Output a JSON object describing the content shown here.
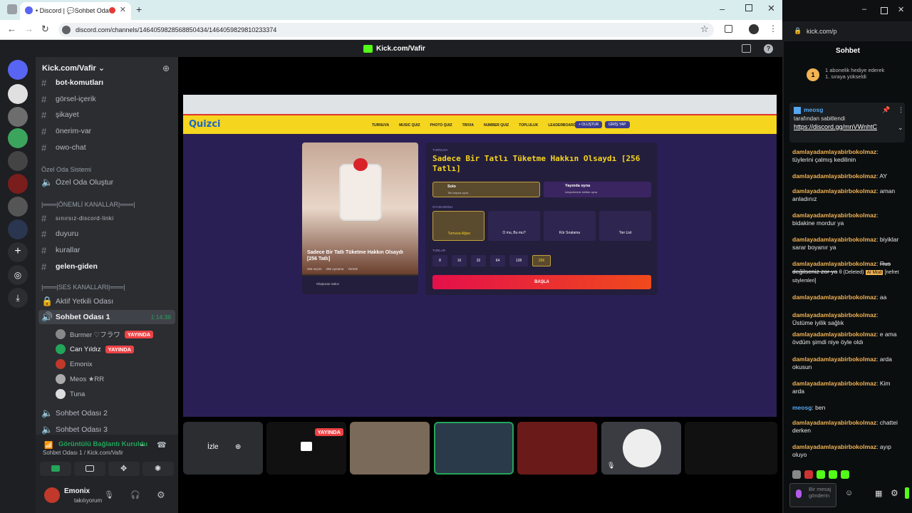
{
  "browser": {
    "tab_title": "• Discord | 💬Sohbet Oda",
    "url": "discord.com/channels/1464059828568850434/1464059829810233374"
  },
  "top": {
    "title": "Kick.com/Vafir"
  },
  "server": {
    "name": "Kick.com/Vafir"
  },
  "channels": [
    {
      "label": "bot-komutları"
    },
    {
      "label": "görsel-içerik"
    },
    {
      "label": "şikayet"
    },
    {
      "label": "önerim-var"
    },
    {
      "label": "owo-chat"
    }
  ],
  "cat_private": "Özel Oda Sistemi",
  "create_room": "Özel Oda Oluştur",
  "cat_important": "|═══|ÖNEMLİ KANALLAR|═══|",
  "important": [
    {
      "label": "sınırsız-discord-linki"
    },
    {
      "label": "duyuru"
    },
    {
      "label": "kurallar"
    },
    {
      "label": "gelen-giden"
    }
  ],
  "cat_voice": "|═══|SES KANALLARI|═══|",
  "voice": [
    {
      "label": "Aktif Yetkili Odası"
    },
    {
      "label": "Sohbet Odası 1",
      "time": "1:14:36"
    },
    {
      "label": "Sohbet Odası 2"
    },
    {
      "label": "Sohbet Odası 3"
    }
  ],
  "voice_users": [
    {
      "name": "Burmer ♡フラワ",
      "live": "YAYINDA"
    },
    {
      "name": "Can Yıldız",
      "live": "YAYINDA"
    },
    {
      "name": "Emonix"
    },
    {
      "name": "Meos ★RR"
    },
    {
      "name": "Tuna"
    }
  ],
  "connection": {
    "status": "Görüntülü Bağlantı Kuruldu",
    "sub": "Sohbet Odası 1 / Kick.com/Vafir"
  },
  "user": {
    "name": "Emonix",
    "status": "takılıyorum"
  },
  "quiz": {
    "logo": "Quizci",
    "nav": [
      "TURNUVA",
      "MUSIC QUIZ",
      "PHOTO QUIZ",
      "TRIVIA",
      "NUMBER QUIZ",
      "TOPLULUK",
      "LEADERBOARD"
    ],
    "btn_create": "+ OLUŞTUR",
    "btn_login": "GİRİŞ YAP",
    "category": "TURNUVA",
    "title": "Sadece Bir Tatlı Tüketme Hakkın Olsaydı [256 Tatlı]",
    "card_title": "Sadece Bir Tatlı Tüketme Hakkın Olsaydı [256 Tatlı]",
    "card_meta": [
      "256 seçim",
      "286 oynama",
      "Yemek"
    ],
    "author": "Oluşturan Sakız",
    "solo": "Solo",
    "solo_sub": "Tek başına oyna",
    "live": "Yayında oyna",
    "live_sub": "İzleyicilerinle birlikte oyna",
    "mode_label": "OYUN MODU",
    "modes": [
      "Turnuva Ağacı",
      "O mu, Bu mu?",
      "Kör Sıralama",
      "Tier List"
    ],
    "rounds_label": "TURLAR",
    "rounds": [
      "8",
      "16",
      "32",
      "64",
      "128",
      "256"
    ],
    "start": "BAŞLA"
  },
  "tiles": {
    "watch": "İzle",
    "live": "YAYINDA"
  },
  "chat": {
    "addr": "kick.com/p",
    "title": "Sohbet",
    "sub_notice": "1 abonelik hediye ederek 1. sıraya yükseldi",
    "pinned_user": "meosg",
    "pinned_by": "tarafından sabitlendi",
    "pinned_link": "https://discord.gg/mnVWnhtC",
    "messages": [
      {
        "user": "damlayadamlayabirbokolmaz",
        "text": "tüylerini çalmış kedilinin"
      },
      {
        "user": "damlayadamlayabirbokolmaz",
        "text": "AY"
      },
      {
        "user": "damlayadamlayabirbokolmaz",
        "text": "aman anladınız"
      },
      {
        "user": "damlayadamlayabirbokolmaz",
        "text": "bidakine mordur ya"
      },
      {
        "user": "damlayadamlayabirbokolmaz",
        "text": "biyiklar sarar boyanır ya"
      },
      {
        "user": "damlayadamlayabirbokolmaz",
        "text": "Rus değilseniz zor ya"
      },
      {
        "user": "damlayadamlayabirbokolmaz",
        "text": "aa"
      },
      {
        "user": "damlayadamlayabirbokolmaz",
        "text": "Üstüme iyilik sağlık"
      },
      {
        "user": "damlayadamlayabirbokolmaz",
        "text": "e ama övdüm şimdi niye öyle oldı"
      },
      {
        "user": "damlayadamlayabirbokolmaz",
        "text": "arda okusun"
      },
      {
        "user": "damlayadamlayabirbokolmaz",
        "text": "Kim arda"
      },
      {
        "user": "meosg",
        "text": "ben"
      },
      {
        "user": "damlayadamlayabirbokolmaz",
        "text": "chattei derken"
      },
      {
        "user": "damlayadamlayabirbokolmaz",
        "text": "ayıp oluyo"
      }
    ],
    "deleted": "θ (Deleted)",
    "deleted_tag": "AI Mod",
    "deleted_note": "[nefret söylemleri]",
    "input_placeholder": "Bir mesaj gönderin"
  }
}
